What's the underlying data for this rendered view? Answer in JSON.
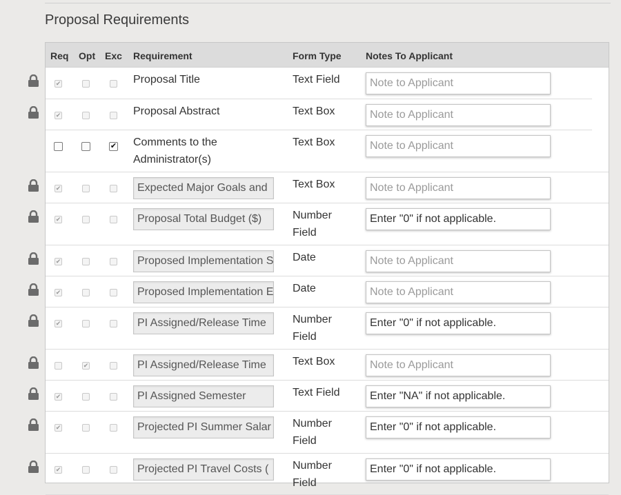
{
  "section": {
    "title": "Proposal Requirements"
  },
  "table": {
    "headers": {
      "req": "Req",
      "opt": "Opt",
      "exc": "Exc",
      "requirement": "Requirement",
      "form_type": "Form Type",
      "notes": "Notes To Applicant"
    },
    "rows": [
      {
        "locked": true,
        "choice": "req",
        "requirement": "Proposal Title",
        "editable": false,
        "form_type": "Text Field",
        "note_value": "",
        "note_placeholder": "Note to Applicant"
      },
      {
        "locked": true,
        "choice": "req",
        "requirement": "Proposal Abstract",
        "editable": false,
        "form_type": "Text Box",
        "note_value": "",
        "note_placeholder": "Note to Applicant"
      },
      {
        "locked": false,
        "choice": "exc",
        "requirement_lines": [
          "Comments to the",
          "Administrator(s)"
        ],
        "editable": false,
        "form_type": "Text Box",
        "note_value": "",
        "note_placeholder": "Note to Applicant"
      },
      {
        "locked": true,
        "choice": "req",
        "requirement": "Expected Major Goals and",
        "editable": true,
        "form_type": "Text Box",
        "note_value": "",
        "note_placeholder": "Note to Applicant"
      },
      {
        "locked": true,
        "choice": "req",
        "requirement": "Proposal Total Budget ($)",
        "editable": true,
        "form_type_lines": [
          "Number",
          "Field"
        ],
        "note_value": "Enter \"0\" if not applicable.",
        "note_placeholder": "Note to Applicant"
      },
      {
        "locked": true,
        "choice": "req",
        "requirement": "Proposed Implementation S",
        "editable": true,
        "form_type": "Date",
        "note_value": "",
        "note_placeholder": "Note to Applicant"
      },
      {
        "locked": true,
        "choice": "req",
        "requirement": "Proposed Implementation E",
        "editable": true,
        "form_type": "Date",
        "note_value": "",
        "note_placeholder": "Note to Applicant"
      },
      {
        "locked": true,
        "choice": "req",
        "requirement": "PI Assigned/Release Time",
        "editable": true,
        "form_type_lines": [
          "Number",
          "Field"
        ],
        "note_value": "Enter \"0\" if not applicable.",
        "note_placeholder": "Note to Applicant"
      },
      {
        "locked": true,
        "choice": "opt",
        "requirement": "PI Assigned/Release Time",
        "editable": true,
        "form_type": "Text Box",
        "note_value": "",
        "note_placeholder": "Note to Applicant"
      },
      {
        "locked": true,
        "choice": "req",
        "requirement": "PI Assigned Semester",
        "editable": true,
        "form_type": "Text Field",
        "note_value": "Enter \"NA\" if not applicable.",
        "note_placeholder": "Note to Applicant"
      },
      {
        "locked": true,
        "choice": "req",
        "requirement": "Projected PI Summer Salar",
        "editable": true,
        "form_type_lines": [
          "Number",
          "Field"
        ],
        "note_value": "Enter \"0\" if not applicable.",
        "note_placeholder": "Note to Applicant"
      },
      {
        "locked": true,
        "choice": "req",
        "requirement": "Projected PI Travel Costs (",
        "editable": true,
        "form_type_lines": [
          "Number",
          "Field"
        ],
        "note_value": "Enter \"0\" if not applicable.",
        "note_placeholder": "Note to Applicant"
      }
    ]
  },
  "icons": {
    "lock": "lock-icon",
    "check": "checkmark-icon"
  },
  "colors": {
    "background": "#ebeae8",
    "header": "#dcdcdc",
    "lock": "#6b6b6b"
  }
}
